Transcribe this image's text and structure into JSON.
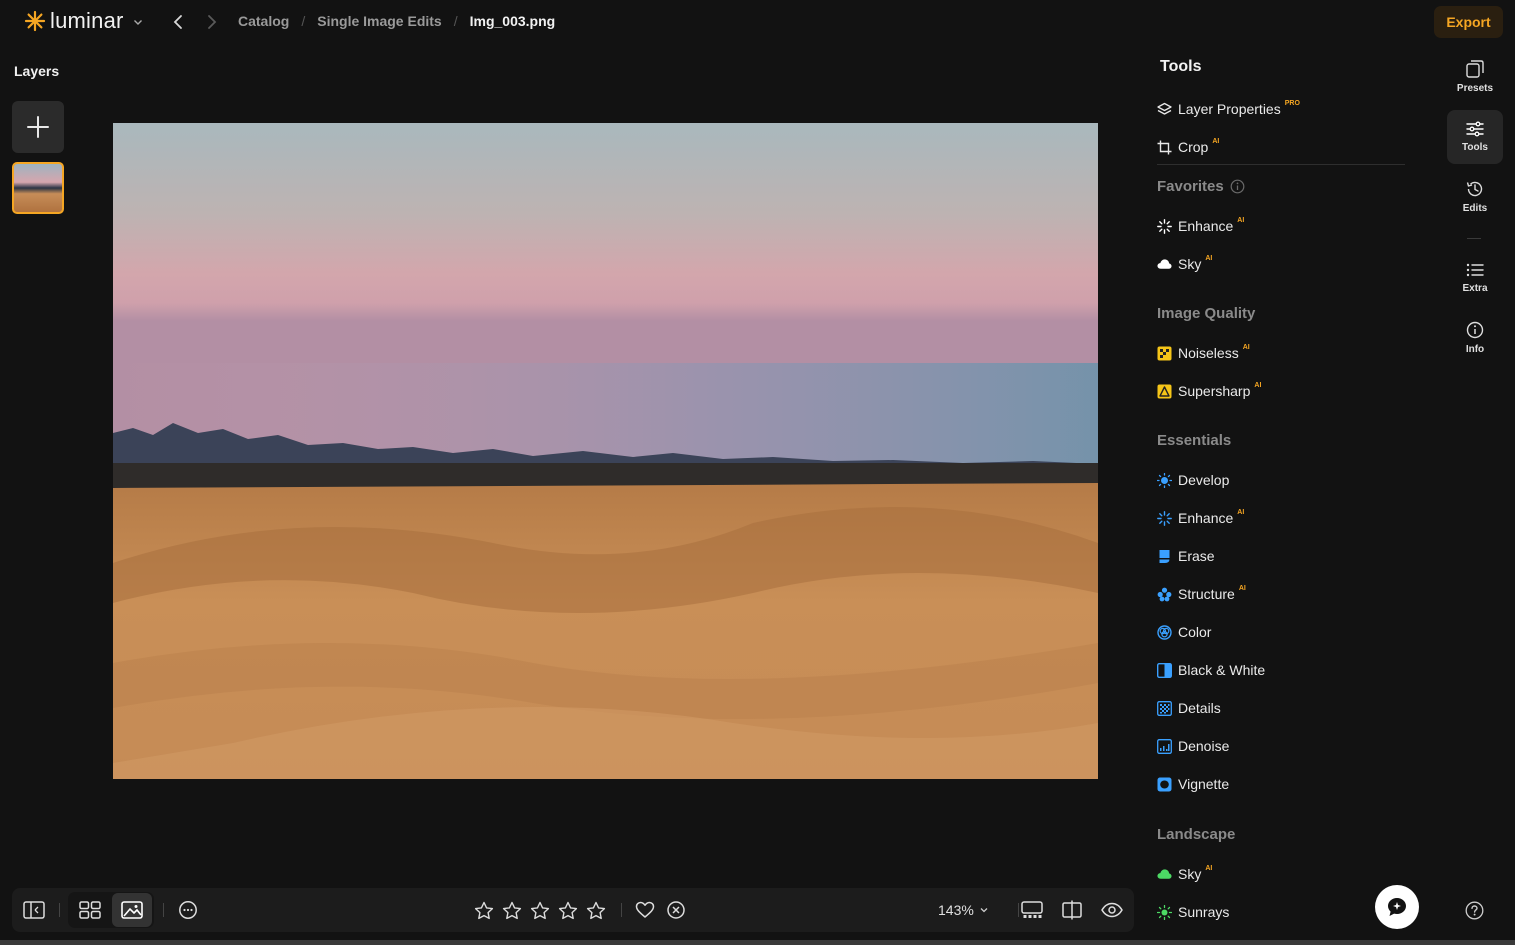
{
  "app": {
    "name": "luminar"
  },
  "breadcrumb": {
    "items": [
      "Catalog",
      "Single Image Edits",
      "Img_003.png"
    ],
    "separator": "/"
  },
  "header": {
    "export_label": "Export"
  },
  "layers": {
    "title": "Layers"
  },
  "tools": {
    "title": "Tools",
    "top_items": [
      {
        "label": "Layer Properties",
        "badge": "PRO",
        "icon": "layers-icon"
      },
      {
        "label": "Crop",
        "badge": "AI",
        "icon": "crop-icon"
      }
    ],
    "sections": [
      {
        "title": "Favorites",
        "items": [
          {
            "label": "Enhance",
            "badge": "AI",
            "icon": "enhance-icon"
          },
          {
            "label": "Sky",
            "badge": "AI",
            "icon": "cloud-icon"
          }
        ]
      },
      {
        "title": "Image Quality",
        "items": [
          {
            "label": "Noiseless",
            "badge": "AI",
            "icon": "noiseless-icon"
          },
          {
            "label": "Supersharp",
            "badge": "AI",
            "icon": "supersharp-icon"
          }
        ]
      },
      {
        "title": "Essentials",
        "items": [
          {
            "label": "Develop",
            "badge": "",
            "icon": "develop-icon"
          },
          {
            "label": "Enhance",
            "badge": "AI",
            "icon": "enhance-icon"
          },
          {
            "label": "Erase",
            "badge": "",
            "icon": "erase-icon"
          },
          {
            "label": "Structure",
            "badge": "AI",
            "icon": "structure-icon"
          },
          {
            "label": "Color",
            "badge": "",
            "icon": "color-icon"
          },
          {
            "label": "Black & White",
            "badge": "",
            "icon": "black-white-icon"
          },
          {
            "label": "Details",
            "badge": "",
            "icon": "details-icon"
          },
          {
            "label": "Denoise",
            "badge": "",
            "icon": "denoise-icon"
          },
          {
            "label": "Vignette",
            "badge": "",
            "icon": "vignette-icon"
          }
        ]
      },
      {
        "title": "Landscape",
        "items": [
          {
            "label": "Sky",
            "badge": "AI",
            "icon": "cloud-icon"
          },
          {
            "label": "Sunrays",
            "badge": "",
            "icon": "sunrays-icon"
          }
        ]
      }
    ]
  },
  "rail": {
    "items": [
      {
        "label": "Presets",
        "icon": "presets-icon",
        "active": false
      },
      {
        "label": "Tools",
        "icon": "sliders-icon",
        "active": true
      },
      {
        "label": "Edits",
        "icon": "history-icon",
        "active": false
      },
      {
        "label": "Extra",
        "icon": "list-icon",
        "active": false
      },
      {
        "label": "Info",
        "icon": "info-icon",
        "active": false
      }
    ]
  },
  "bottombar": {
    "zoom_label": "143%",
    "rating_stars": 5,
    "rating_value": 0
  },
  "colors": {
    "accent": "#f5a623",
    "background": "#121212",
    "panel": "#1c1c1c"
  }
}
